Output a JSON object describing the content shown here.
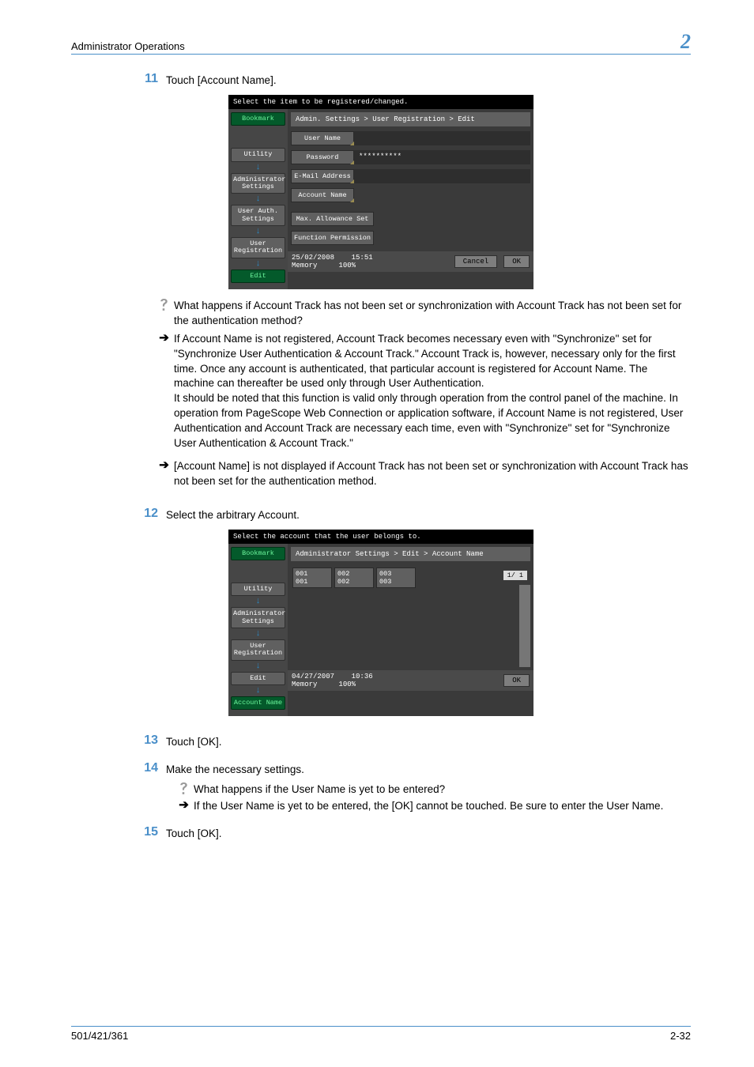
{
  "header": {
    "title": "Administrator Operations",
    "chapter": "2"
  },
  "steps": {
    "s11": {
      "num": "11",
      "text": "Touch [Account Name]."
    },
    "s12": {
      "num": "12",
      "text": "Select the arbitrary Account."
    },
    "s13": {
      "num": "13",
      "text": "Touch [OK]."
    },
    "s14": {
      "num": "14",
      "text": "Make the necessary settings."
    },
    "s15": {
      "num": "15",
      "text": "Touch [OK]."
    }
  },
  "annots": {
    "q1": "What happens if Account Track has not been set or synchronization with Account Track has not been set for the authentication method?",
    "a1": "If Account Name is not registered, Account Track becomes necessary even with \"Synchronize\" set for \"Synchronize User Authentication & Account Track.\" Account Track is, however, necessary only for the first time. Once any account is authenticated, that particular account is registered for Account Name. The machine can thereafter be used only through User Authentication.\nIt should be noted that this function is valid only through operation from the control panel of the machine. In operation from PageScope Web Connection or application software, if Account Name is not registered, User Authentication and Account Track are necessary each time, even with \"Synchronize\" set for \"Synchronize User Authentication & Account Track.\"",
    "a2": "[Account Name] is not displayed if Account Track has not been set or synchronization with Account Track has not been set for the authentication method.",
    "q2": "What happens if the User Name is yet to be entered?",
    "a3": "If the User Name is yet to be entered, the [OK] cannot be touched. Be sure to enter the User Name."
  },
  "panel1": {
    "header": "Select the item to be registered/changed.",
    "breadcrumb": "Admin. Settings > User Registration > Edit",
    "side": {
      "bookmark": "Bookmark",
      "utility": "Utility",
      "admin": "Administrator Settings",
      "userauth": "User Auth. Settings",
      "userreg": "User Registration",
      "edit": "Edit"
    },
    "fields": {
      "user_name": "User Name",
      "password": "Password",
      "password_val": "**********",
      "email": "E-Mail Address",
      "account": "Account Name",
      "maxallow": "Max. Allowance Set",
      "funcperm": "Function Permission"
    },
    "footer": {
      "date": "25/02/2008",
      "time": "15:51",
      "mem_label": "Memory",
      "mem_val": "100%",
      "cancel": "Cancel",
      "ok": "OK"
    }
  },
  "panel2": {
    "header": "Select the account that the user belongs to.",
    "breadcrumb": "Administrator Settings > Edit > Account Name",
    "page_ind": "1/  1",
    "side": {
      "bookmark": "Bookmark",
      "utility": "Utility",
      "admin": "Administrator Settings",
      "userreg": "User Registration",
      "edit": "Edit",
      "account": "Account Name"
    },
    "accounts": [
      {
        "code": "001",
        "name": "001"
      },
      {
        "code": "002",
        "name": "002"
      },
      {
        "code": "003",
        "name": "003"
      }
    ],
    "footer": {
      "date": "04/27/2007",
      "time": "10:36",
      "mem_label": "Memory",
      "mem_val": "100%",
      "ok": "OK"
    }
  },
  "footer": {
    "model": "501/421/361",
    "page": "2-32"
  }
}
